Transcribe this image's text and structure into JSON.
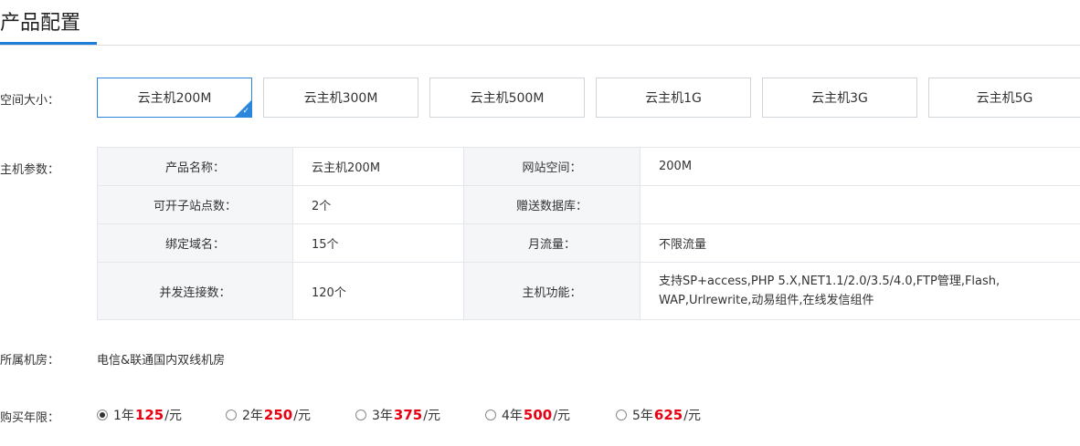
{
  "header": {
    "title": "产品配置"
  },
  "labels": {
    "space_size": "空间大小：",
    "host_params": "主机参数：",
    "room": "所属机房：",
    "years": "购买年限："
  },
  "size_options": [
    {
      "label": "云主机200M",
      "selected": true
    },
    {
      "label": "云主机300M",
      "selected": false
    },
    {
      "label": "云主机500M",
      "selected": false
    },
    {
      "label": "云主机1G",
      "selected": false
    },
    {
      "label": "云主机3G",
      "selected": false
    },
    {
      "label": "云主机5G",
      "selected": false
    }
  ],
  "params": {
    "rows": [
      {
        "k1": "产品名称：",
        "v1": "云主机200M",
        "k2": "网站空间：",
        "v2": "200M"
      },
      {
        "k1": "可开子站点数：",
        "v1": "2个",
        "k2": "赠送数据库：",
        "v2": ""
      },
      {
        "k1": "绑定域名：",
        "v1": "15个",
        "k2": "月流量：",
        "v2": "不限流量"
      },
      {
        "k1": "并发连接数：",
        "v1": "120个",
        "k2": "主机功能：",
        "v2_line1": "支持SP+access,PHP 5.X,NET1.1/2.0/3.5/4.0,FTP管理,Flash,",
        "v2_line2": "WAP,Urlrewrite,动易组件,在线发信组件"
      }
    ]
  },
  "room_value": "电信&联通国内双线机房",
  "years": [
    {
      "year": "1年",
      "price": "125",
      "unit": "/元",
      "checked": true
    },
    {
      "year": "2年",
      "price": "250",
      "unit": "/元",
      "checked": false
    },
    {
      "year": "3年",
      "price": "375",
      "unit": "/元",
      "checked": false
    },
    {
      "year": "4年",
      "price": "500",
      "unit": "/元",
      "checked": false
    },
    {
      "year": "5年",
      "price": "625",
      "unit": "/元",
      "checked": false
    }
  ],
  "colors": {
    "accent": "#2b86dc",
    "price": "#e60012",
    "table_key_bg": "#f5f6f8"
  }
}
